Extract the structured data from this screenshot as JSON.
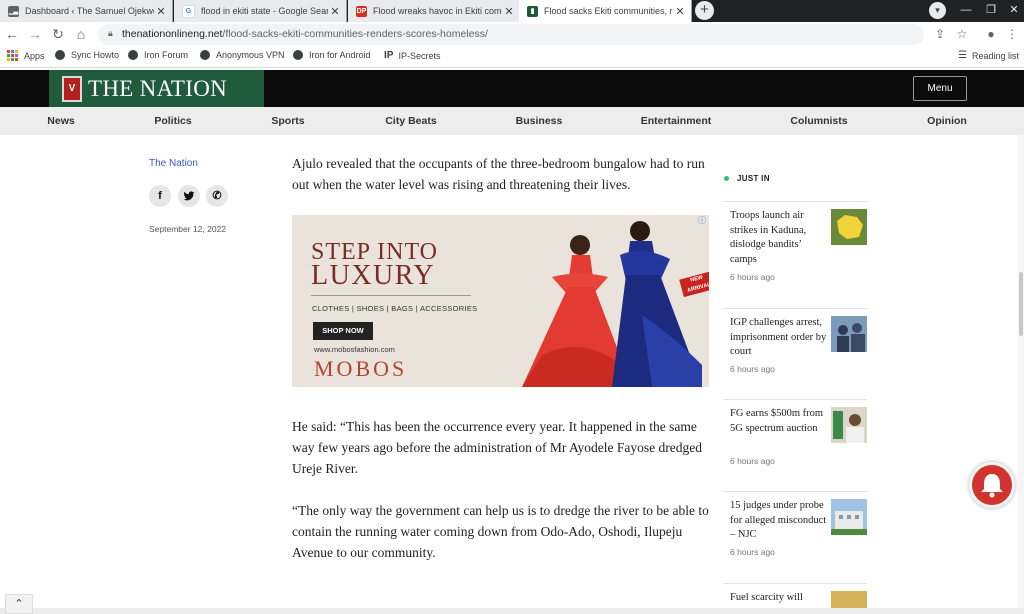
{
  "browser": {
    "tabs": [
      {
        "title": "Dashboard ‹ The Samuel Ojekwe",
        "favicon": "dashboard",
        "active": false
      },
      {
        "title": "flood in ekiti state - Google Sear",
        "favicon": "G",
        "active": false
      },
      {
        "title": "Flood wreaks havoc in Ekiti comm",
        "favicon": "DP",
        "active": false
      },
      {
        "title": "Flood sacks Ekiti communities, re",
        "favicon": "nation",
        "active": true
      }
    ],
    "url_domain": "thenationonlineng.net",
    "url_path": "/flood-sacks-ekiti-communities-renders-scores-homeless/",
    "bookmarks": [
      "Apps",
      "Sync Howto",
      "Iron Forum",
      "Anonymous VPN",
      "Iron for Android",
      "IP-Secrets"
    ],
    "reading_list": "Reading list"
  },
  "site": {
    "logo_text": "THE NATION",
    "menu_label": "Menu",
    "categories": [
      "News",
      "Politics",
      "Sports",
      "City Beats",
      "Business",
      "Entertainment",
      "Columnists",
      "Opinion"
    ]
  },
  "article": {
    "byline": "The Nation",
    "date": "September 12, 2022",
    "paragraphs": [
      "Ajulo revealed that the occupants of the three-bedroom bungalow had to run out when the water level was rising and threatening their lives.",
      "He said: “This has been the occurrence every year. It happened in the same way few years ago before the administration of Mr Ayodele Fayose dredged Ureje River.",
      "“The only way the government can help us is to dredge the river to be able to contain the running water coming down from Odo-Ado, Oshodi, Ilupeju Avenue to our community."
    ]
  },
  "ad": {
    "headline1": "STEP INTO",
    "headline2": "LUXURY",
    "categories": "CLOTHES | SHOES | BAGS | ACCESSORIES",
    "cta": "SHOP NOW",
    "site": "www.mobosfashion.com",
    "brand": "MOBOS",
    "badge": "NEW ARRIVAL"
  },
  "sidebar": {
    "heading": "JUST IN",
    "items": [
      {
        "title": "Troops launch air strikes in Kaduna, dislodge bandits’ camps",
        "time": "6 hours ago"
      },
      {
        "title": "IGP challenges arrest, imprisonment order by court",
        "time": "6 hours ago"
      },
      {
        "title": "FG earns $500m from 5G spectrum auction",
        "time": "6 hours ago"
      },
      {
        "title": "15 judges under probe for alleged misconduct – NJC",
        "time": "6 hours ago"
      },
      {
        "title": "Fuel scarcity will",
        "time": ""
      }
    ]
  },
  "colors": {
    "logo_green": "#1f5b3c",
    "header_black": "#0b0b0b",
    "byline_blue": "#3d56c6",
    "just_in_dot": "#2fbf71",
    "bell_red": "#d1342d"
  }
}
